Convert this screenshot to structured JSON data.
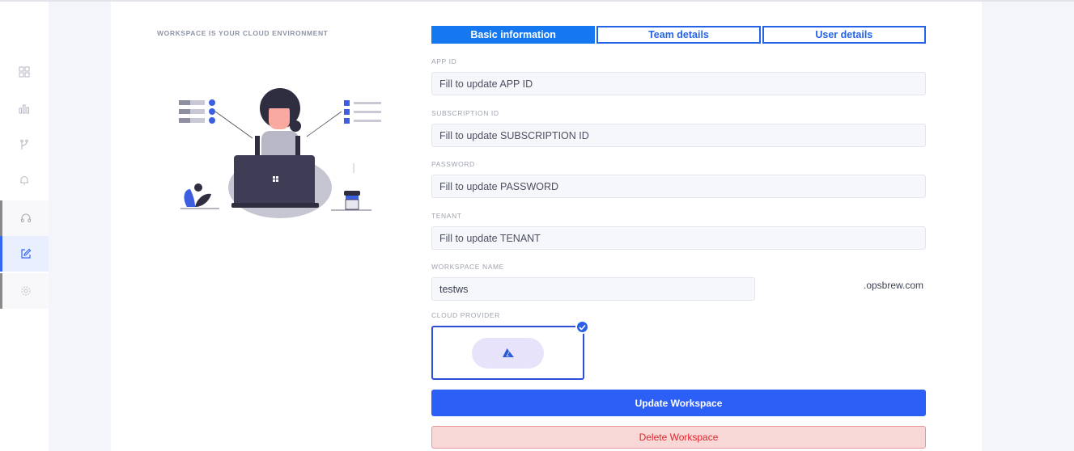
{
  "sidebar": {
    "items": [
      {
        "icon": "dashboard-grid-icon"
      },
      {
        "icon": "bar-chart-icon"
      },
      {
        "icon": "git-branch-icon"
      },
      {
        "icon": "bell-icon"
      },
      {
        "icon": "headset-icon"
      },
      {
        "icon": "edit-icon"
      },
      {
        "icon": "settings-gear-icon"
      }
    ]
  },
  "main": {
    "tagline": "WORKSPACE IS YOUR CLOUD ENVIRONMENT",
    "tabs": [
      {
        "label": "Basic information",
        "active": true
      },
      {
        "label": "Team details",
        "active": false
      },
      {
        "label": "User details",
        "active": false
      }
    ],
    "fields": {
      "app_id": {
        "label": "APP ID",
        "placeholder": "Fill to update APP ID",
        "value": ""
      },
      "subscription_id": {
        "label": "SUBSCRIPTION ID",
        "placeholder": "Fill to update SUBSCRIPTION ID",
        "value": ""
      },
      "password": {
        "label": "PASSWORD",
        "placeholder": "Fill to update PASSWORD",
        "value": ""
      },
      "tenant": {
        "label": "TENANT",
        "placeholder": "Fill to update TENANT",
        "value": ""
      },
      "workspace_name": {
        "label": "WORKSPACE NAME",
        "value": "testws",
        "suffix": ".opsbrew.com"
      }
    },
    "cloud_provider": {
      "label": "CLOUD PROVIDER",
      "selected_icon": "azure-logo-icon",
      "selected": true
    },
    "buttons": {
      "update": "Update Workspace",
      "delete": "Delete Workspace"
    }
  },
  "colors": {
    "primary": "#2c5ff6",
    "tab_active": "#1678f0",
    "danger_text": "#e0262c",
    "danger_bg": "#f8d7d7",
    "page_bg": "#f4f5fa"
  }
}
